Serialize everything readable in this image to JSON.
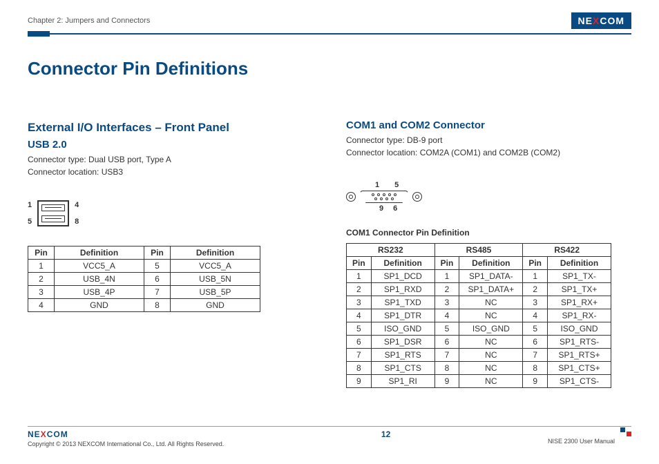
{
  "header": {
    "chapter": "Chapter 2: Jumpers and Connectors",
    "logo_text": "NEXCOM"
  },
  "title": "Connector Pin Definitions",
  "subtitle": "External I/O Interfaces – Front Panel",
  "left": {
    "heading": "USB 2.0",
    "connector_type": "Connector type: Dual USB port, Type A",
    "connector_location": "Connector location: USB3",
    "diagram_pins": {
      "tl": "1",
      "tr": "4",
      "bl": "5",
      "br": "8"
    },
    "table": {
      "headers": {
        "pin": "Pin",
        "def": "Definition"
      },
      "rows": [
        {
          "p1": "1",
          "d1": "VCC5_A",
          "p2": "5",
          "d2": "VCC5_A"
        },
        {
          "p1": "2",
          "d1": "USB_4N",
          "p2": "6",
          "d2": "USB_5N"
        },
        {
          "p1": "3",
          "d1": "USB_4P",
          "p2": "7",
          "d2": "USB_5P"
        },
        {
          "p1": "4",
          "d1": "GND",
          "p2": "8",
          "d2": "GND"
        }
      ]
    }
  },
  "right": {
    "heading": "COM1 and COM2 Connector",
    "connector_type": "Connector type: DB-9 port",
    "connector_location": "Connector location: COM2A (COM1) and COM2B (COM2)",
    "diagram_pins": {
      "t1": "1",
      "t2": "5",
      "b1": "9",
      "b2": "6"
    },
    "table_caption": "COM1 Connector Pin Definition",
    "groups": {
      "g1": "RS232",
      "g2": "RS485",
      "g3": "RS422"
    },
    "headers": {
      "pin": "Pin",
      "def": "Definition"
    },
    "rows": [
      {
        "p": "1",
        "d1": "SP1_DCD",
        "d2": "SP1_DATA-",
        "d3": "SP1_TX-"
      },
      {
        "p": "2",
        "d1": "SP1_RXD",
        "d2": "SP1_DATA+",
        "d3": "SP1_TX+"
      },
      {
        "p": "3",
        "d1": "SP1_TXD",
        "d2": "NC",
        "d3": "SP1_RX+"
      },
      {
        "p": "4",
        "d1": "SP1_DTR",
        "d2": "NC",
        "d3": "SP1_RX-"
      },
      {
        "p": "5",
        "d1": "ISO_GND",
        "d2": "ISO_GND",
        "d3": "ISO_GND"
      },
      {
        "p": "6",
        "d1": "SP1_DSR",
        "d2": "NC",
        "d3": "SP1_RTS-"
      },
      {
        "p": "7",
        "d1": "SP1_RTS",
        "d2": "NC",
        "d3": "SP1_RTS+"
      },
      {
        "p": "8",
        "d1": "SP1_CTS",
        "d2": "NC",
        "d3": "SP1_CTS+"
      },
      {
        "p": "9",
        "d1": "SP1_RI",
        "d2": "NC",
        "d3": "SP1_CTS-"
      }
    ]
  },
  "footer": {
    "copyright": "Copyright © 2013 NEXCOM International Co., Ltd. All Rights Reserved.",
    "page": "12",
    "manual": "NISE 2300 User Manual"
  }
}
